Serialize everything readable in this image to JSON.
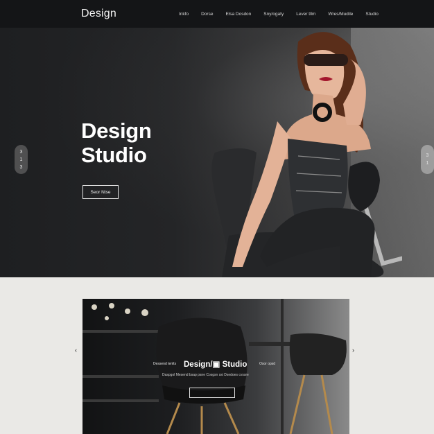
{
  "header": {
    "logo": "Design",
    "nav": [
      "Inkfo",
      "Dorse",
      "Elsa Dosdon",
      "Sny/ogaty",
      "Lever tllm",
      "Wres/Mudile",
      "Studio"
    ]
  },
  "hero": {
    "title_line1": "Design",
    "title_line2": "Studio",
    "button_label": "Seor Ntse",
    "left_pill": [
      "3",
      "1",
      "3"
    ],
    "right_pill": [
      "3",
      "1"
    ]
  },
  "card": {
    "title": "Design/▣ Studio",
    "tag_left": "Dessend tenlts",
    "tag_right": "Osor opsd",
    "subtitle": "Daspgol Mesend bsap    psne  Cosgsn  ssi  Dsedoes cvssre"
  },
  "carousel": {
    "prev_icon": "‹",
    "next_icon": "›"
  },
  "colors": {
    "topbar": "#141517",
    "accent_lips": "#a3162c"
  }
}
